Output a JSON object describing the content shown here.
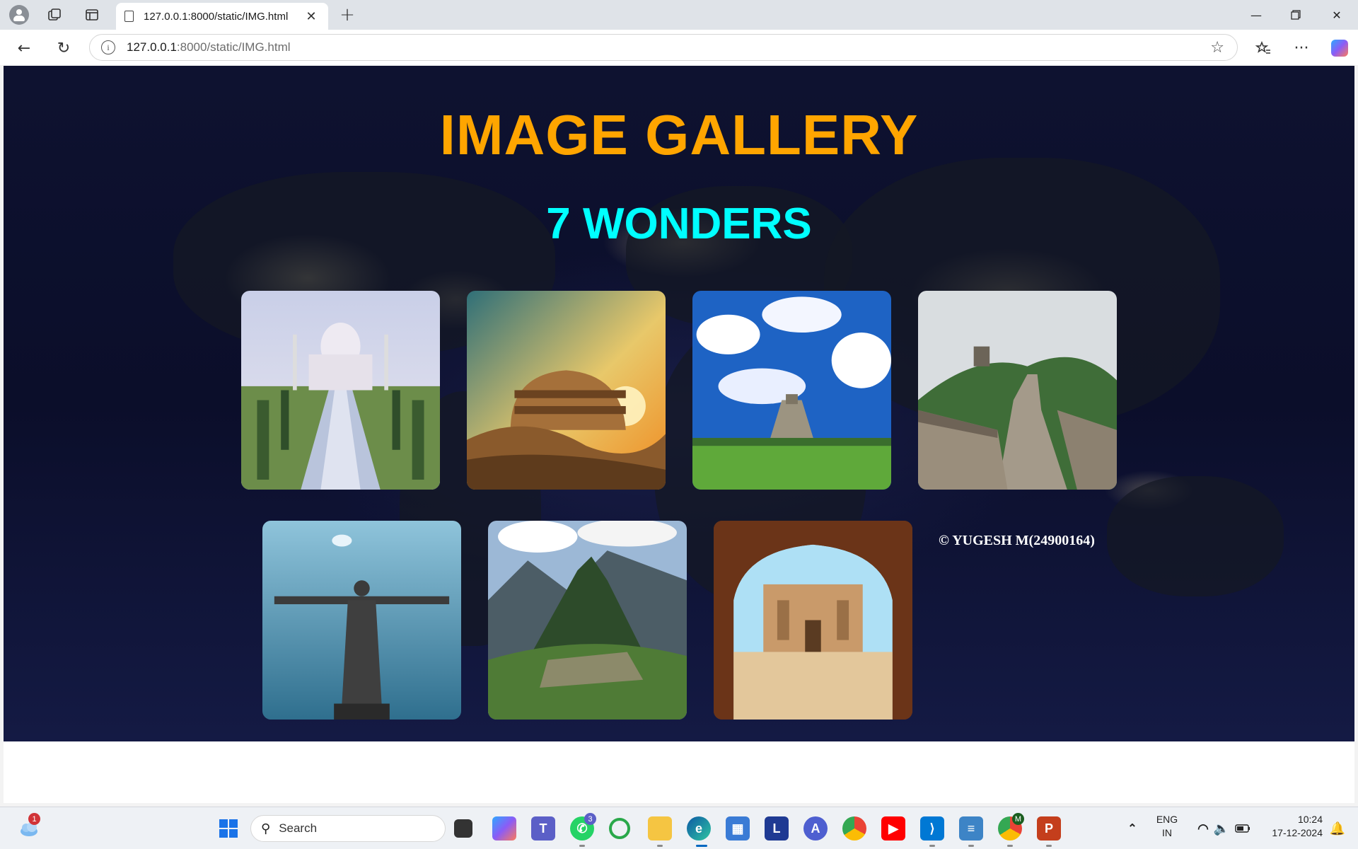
{
  "browser": {
    "tab_title": "127.0.0.1:8000/static/IMG.html",
    "url_host": "127.0.0.1",
    "url_path": ":8000/static/IMG.html"
  },
  "page": {
    "title": "IMAGE GALLERY",
    "subtitle": "7 WONDERS",
    "copyright": "© YUGESH M(24900164)",
    "images": [
      {
        "icon": "taj-mahal-image"
      },
      {
        "icon": "colosseum-image"
      },
      {
        "icon": "chichen-itza-image"
      },
      {
        "icon": "great-wall-image"
      },
      {
        "icon": "christ-the-redeemer-image"
      },
      {
        "icon": "machu-picchu-image"
      },
      {
        "icon": "petra-image"
      }
    ]
  },
  "taskbar": {
    "search_label": "Search",
    "weather_badge": "1",
    "teams_badge": "3",
    "chrome_badge": "M",
    "lang_line1": "ENG",
    "lang_line2": "IN",
    "time": "10:24",
    "date": "17-12-2024"
  }
}
